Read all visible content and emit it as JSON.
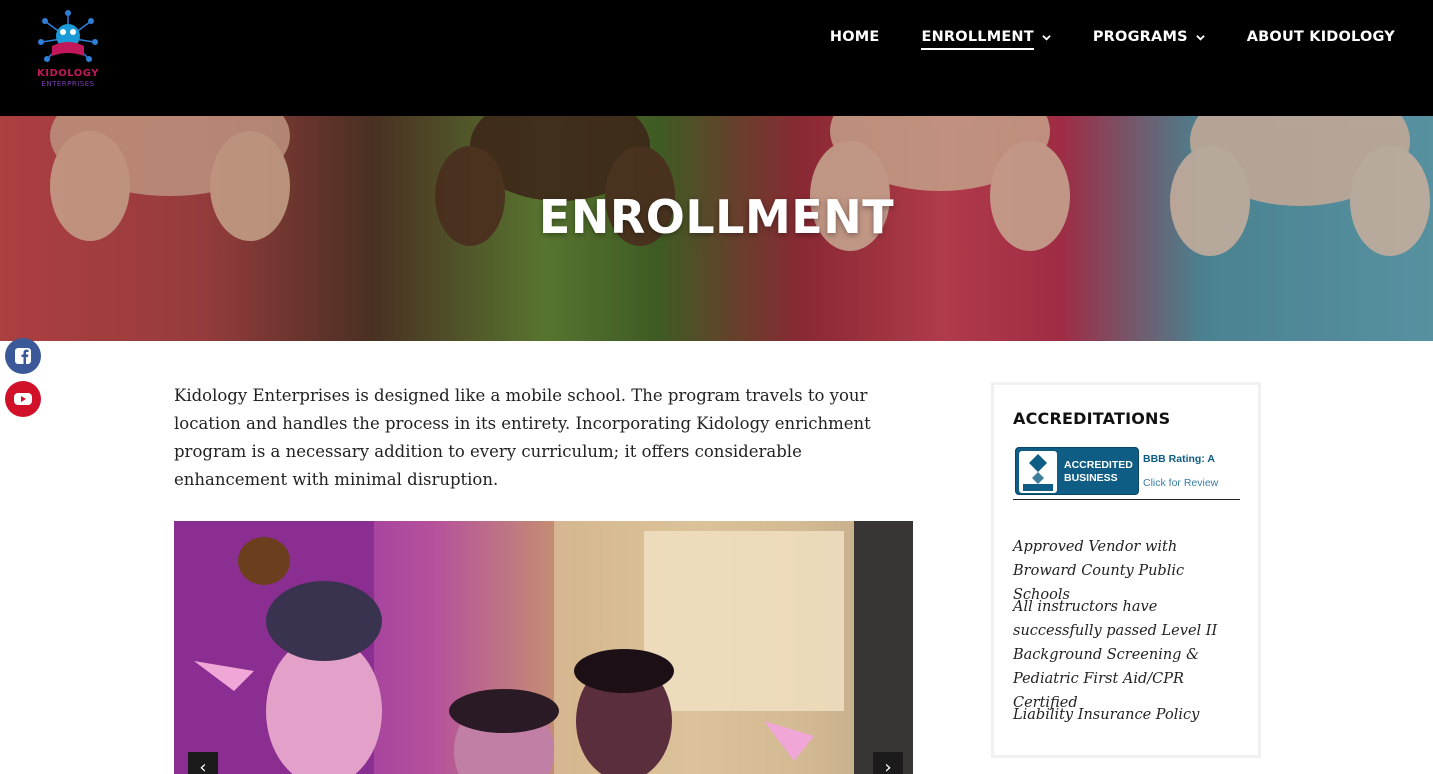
{
  "brand": {
    "logo_line1": "KIDOLOGY",
    "logo_line2": "ENTERPRISES"
  },
  "nav": {
    "items": [
      {
        "label": "HOME",
        "dropdown": false,
        "active": false
      },
      {
        "label": "ENROLLMENT",
        "dropdown": true,
        "active": true
      },
      {
        "label": "PROGRAMS",
        "dropdown": true,
        "active": false
      },
      {
        "label": "ABOUT KIDOLOGY",
        "dropdown": false,
        "active": false
      }
    ]
  },
  "hero": {
    "title": "ENROLLMENT"
  },
  "social": {
    "icons": [
      "facebook-icon",
      "youtube-icon"
    ],
    "facebook_color": "#3b5998",
    "youtube_color": "#d1102a"
  },
  "main": {
    "intro": "Kidology Enterprises is designed like a mobile school.  The program travels to your location and handles the process in its entirety.  Incorporating Kidology  enrichment program is a necessary addition to every curriculum; it offers considerable enhancement with minimal disruption.",
    "slider_prev": "‹",
    "slider_next": "›"
  },
  "sidebar": {
    "title": "ACCREDITATIONS",
    "bbb": {
      "logo_text": "BBB",
      "accredited_line1": "ACCREDITED",
      "accredited_line2": "BUSINESS",
      "rating": "BBB Rating: A",
      "click": "Click for Review"
    },
    "items": [
      "Approved Vendor with Broward County Public Schools",
      "All instructors have successfully passed Level II Background Screening & Pediatric First Aid/CPR Certified",
      "Liability Insurance Policy"
    ]
  },
  "colors": {
    "header_bg": "#000000",
    "bbb_blue": "#0f5d84"
  }
}
